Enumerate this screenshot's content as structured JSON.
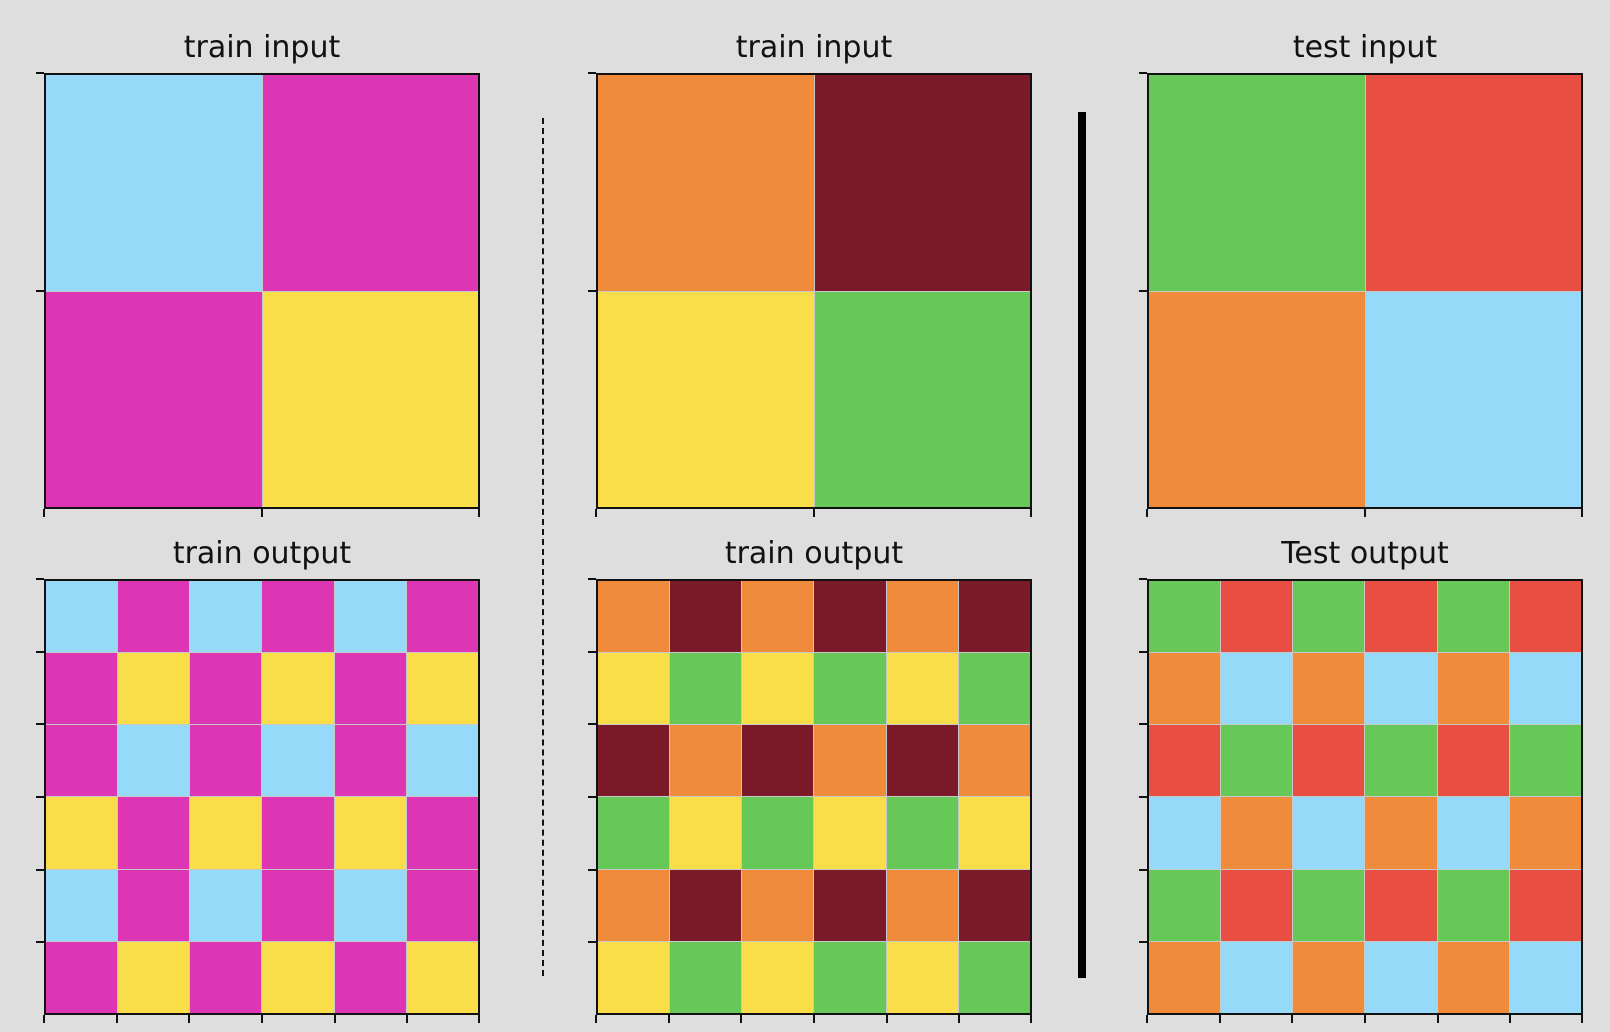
{
  "palette": {
    "0": "#000000",
    "1": "#1E93FF",
    "2": "#E84E42",
    "3": "#66C957",
    "4": "#F9DE4A",
    "5": "#999999",
    "6": "#DC36B5",
    "7": "#EF8B3A",
    "8": "#96DAFA",
    "9": "#7B1A28"
  },
  "panels": [
    {
      "title": "train input",
      "grid": [
        [
          8,
          6
        ],
        [
          6,
          4
        ]
      ]
    },
    {
      "title": "train input",
      "grid": [
        [
          7,
          9
        ],
        [
          4,
          3
        ]
      ]
    },
    {
      "title": "test input",
      "grid": [
        [
          3,
          2
        ],
        [
          7,
          8
        ]
      ]
    },
    {
      "title": "train output",
      "grid": [
        [
          8,
          6,
          8,
          6,
          8,
          6
        ],
        [
          6,
          4,
          6,
          4,
          6,
          4
        ],
        [
          6,
          8,
          6,
          8,
          6,
          8
        ],
        [
          4,
          6,
          4,
          6,
          4,
          6
        ],
        [
          8,
          6,
          8,
          6,
          8,
          6
        ],
        [
          6,
          4,
          6,
          4,
          6,
          4
        ]
      ]
    },
    {
      "title": "train output",
      "grid": [
        [
          7,
          9,
          7,
          9,
          7,
          9
        ],
        [
          4,
          3,
          4,
          3,
          4,
          3
        ],
        [
          9,
          7,
          9,
          7,
          9,
          7
        ],
        [
          3,
          4,
          3,
          4,
          3,
          4
        ],
        [
          7,
          9,
          7,
          9,
          7,
          9
        ],
        [
          4,
          3,
          4,
          3,
          4,
          3
        ]
      ]
    },
    {
      "title": "Test output",
      "grid": [
        [
          3,
          2,
          3,
          2,
          3,
          2
        ],
        [
          7,
          8,
          7,
          8,
          7,
          8
        ],
        [
          2,
          3,
          2,
          3,
          2,
          3
        ],
        [
          8,
          7,
          8,
          7,
          8,
          7
        ],
        [
          3,
          2,
          3,
          2,
          3,
          2
        ],
        [
          7,
          8,
          7,
          8,
          7,
          8
        ]
      ]
    }
  ]
}
